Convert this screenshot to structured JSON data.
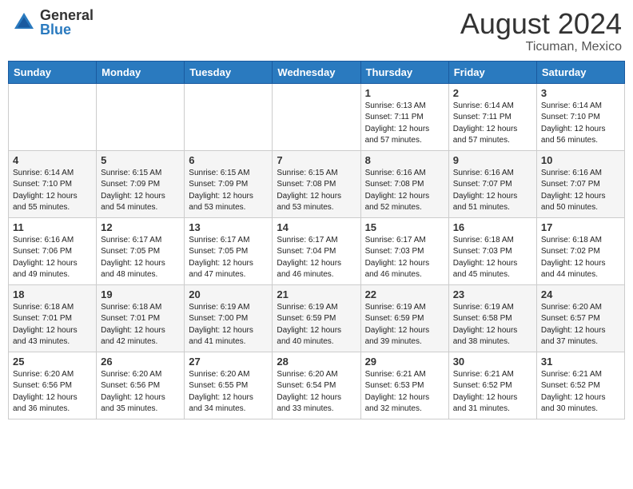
{
  "header": {
    "logo_general": "General",
    "logo_blue": "Blue",
    "month_title": "August 2024",
    "location": "Ticuman, Mexico"
  },
  "weekdays": [
    "Sunday",
    "Monday",
    "Tuesday",
    "Wednesday",
    "Thursday",
    "Friday",
    "Saturday"
  ],
  "weeks": [
    [
      {
        "day": "",
        "info": ""
      },
      {
        "day": "",
        "info": ""
      },
      {
        "day": "",
        "info": ""
      },
      {
        "day": "",
        "info": ""
      },
      {
        "day": "1",
        "info": "Sunrise: 6:13 AM\nSunset: 7:11 PM\nDaylight: 12 hours\nand 57 minutes."
      },
      {
        "day": "2",
        "info": "Sunrise: 6:14 AM\nSunset: 7:11 PM\nDaylight: 12 hours\nand 57 minutes."
      },
      {
        "day": "3",
        "info": "Sunrise: 6:14 AM\nSunset: 7:10 PM\nDaylight: 12 hours\nand 56 minutes."
      }
    ],
    [
      {
        "day": "4",
        "info": "Sunrise: 6:14 AM\nSunset: 7:10 PM\nDaylight: 12 hours\nand 55 minutes."
      },
      {
        "day": "5",
        "info": "Sunrise: 6:15 AM\nSunset: 7:09 PM\nDaylight: 12 hours\nand 54 minutes."
      },
      {
        "day": "6",
        "info": "Sunrise: 6:15 AM\nSunset: 7:09 PM\nDaylight: 12 hours\nand 53 minutes."
      },
      {
        "day": "7",
        "info": "Sunrise: 6:15 AM\nSunset: 7:08 PM\nDaylight: 12 hours\nand 53 minutes."
      },
      {
        "day": "8",
        "info": "Sunrise: 6:16 AM\nSunset: 7:08 PM\nDaylight: 12 hours\nand 52 minutes."
      },
      {
        "day": "9",
        "info": "Sunrise: 6:16 AM\nSunset: 7:07 PM\nDaylight: 12 hours\nand 51 minutes."
      },
      {
        "day": "10",
        "info": "Sunrise: 6:16 AM\nSunset: 7:07 PM\nDaylight: 12 hours\nand 50 minutes."
      }
    ],
    [
      {
        "day": "11",
        "info": "Sunrise: 6:16 AM\nSunset: 7:06 PM\nDaylight: 12 hours\nand 49 minutes."
      },
      {
        "day": "12",
        "info": "Sunrise: 6:17 AM\nSunset: 7:05 PM\nDaylight: 12 hours\nand 48 minutes."
      },
      {
        "day": "13",
        "info": "Sunrise: 6:17 AM\nSunset: 7:05 PM\nDaylight: 12 hours\nand 47 minutes."
      },
      {
        "day": "14",
        "info": "Sunrise: 6:17 AM\nSunset: 7:04 PM\nDaylight: 12 hours\nand 46 minutes."
      },
      {
        "day": "15",
        "info": "Sunrise: 6:17 AM\nSunset: 7:03 PM\nDaylight: 12 hours\nand 46 minutes."
      },
      {
        "day": "16",
        "info": "Sunrise: 6:18 AM\nSunset: 7:03 PM\nDaylight: 12 hours\nand 45 minutes."
      },
      {
        "day": "17",
        "info": "Sunrise: 6:18 AM\nSunset: 7:02 PM\nDaylight: 12 hours\nand 44 minutes."
      }
    ],
    [
      {
        "day": "18",
        "info": "Sunrise: 6:18 AM\nSunset: 7:01 PM\nDaylight: 12 hours\nand 43 minutes."
      },
      {
        "day": "19",
        "info": "Sunrise: 6:18 AM\nSunset: 7:01 PM\nDaylight: 12 hours\nand 42 minutes."
      },
      {
        "day": "20",
        "info": "Sunrise: 6:19 AM\nSunset: 7:00 PM\nDaylight: 12 hours\nand 41 minutes."
      },
      {
        "day": "21",
        "info": "Sunrise: 6:19 AM\nSunset: 6:59 PM\nDaylight: 12 hours\nand 40 minutes."
      },
      {
        "day": "22",
        "info": "Sunrise: 6:19 AM\nSunset: 6:59 PM\nDaylight: 12 hours\nand 39 minutes."
      },
      {
        "day": "23",
        "info": "Sunrise: 6:19 AM\nSunset: 6:58 PM\nDaylight: 12 hours\nand 38 minutes."
      },
      {
        "day": "24",
        "info": "Sunrise: 6:20 AM\nSunset: 6:57 PM\nDaylight: 12 hours\nand 37 minutes."
      }
    ],
    [
      {
        "day": "25",
        "info": "Sunrise: 6:20 AM\nSunset: 6:56 PM\nDaylight: 12 hours\nand 36 minutes."
      },
      {
        "day": "26",
        "info": "Sunrise: 6:20 AM\nSunset: 6:56 PM\nDaylight: 12 hours\nand 35 minutes."
      },
      {
        "day": "27",
        "info": "Sunrise: 6:20 AM\nSunset: 6:55 PM\nDaylight: 12 hours\nand 34 minutes."
      },
      {
        "day": "28",
        "info": "Sunrise: 6:20 AM\nSunset: 6:54 PM\nDaylight: 12 hours\nand 33 minutes."
      },
      {
        "day": "29",
        "info": "Sunrise: 6:21 AM\nSunset: 6:53 PM\nDaylight: 12 hours\nand 32 minutes."
      },
      {
        "day": "30",
        "info": "Sunrise: 6:21 AM\nSunset: 6:52 PM\nDaylight: 12 hours\nand 31 minutes."
      },
      {
        "day": "31",
        "info": "Sunrise: 6:21 AM\nSunset: 6:52 PM\nDaylight: 12 hours\nand 30 minutes."
      }
    ]
  ]
}
